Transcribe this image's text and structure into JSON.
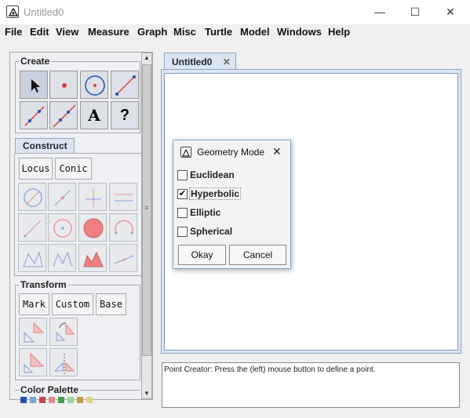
{
  "window": {
    "title": "Untitled0",
    "min": "—",
    "max": "☐",
    "close": "✕"
  },
  "menu": [
    "File",
    "Edit",
    "View",
    "Measure",
    "Graph",
    "Misc",
    "Turtle",
    "Model",
    "Windows",
    "Help"
  ],
  "create": {
    "title": "Create",
    "text_tool": "A",
    "help_tool": "?"
  },
  "construct": {
    "tab": "Construct",
    "locus": "Locus",
    "conic": "Conic"
  },
  "transform": {
    "title": "Transform",
    "mark": "Mark",
    "custom": "Custom",
    "base": "Base"
  },
  "palette": {
    "title": "Color Palette",
    "colors": [
      "#1f4fb8",
      "#7aa0e0",
      "#c04a4a",
      "#e08b8b",
      "#4aa04a",
      "#a0d0a0",
      "#c0a040",
      "#e0d090"
    ]
  },
  "doc_tab": {
    "label": "Untitled0",
    "close": "✕"
  },
  "status": {
    "text": "Point Creator: Press the (left) mouse button to define a point."
  },
  "dialog": {
    "title": "Geometry Mode",
    "close": "✕",
    "options": [
      {
        "label": "Euclidean",
        "checked": false
      },
      {
        "label": "Hyperbolic",
        "checked": true
      },
      {
        "label": "Elliptic",
        "checked": false
      },
      {
        "label": "Spherical",
        "checked": false
      }
    ],
    "check_mark": "✔",
    "okay": "Okay",
    "cancel": "Cancel"
  },
  "colors": {
    "accent": "#7aa0d4",
    "tool_red": "#e04040",
    "tool_blue": "#2050c0"
  }
}
